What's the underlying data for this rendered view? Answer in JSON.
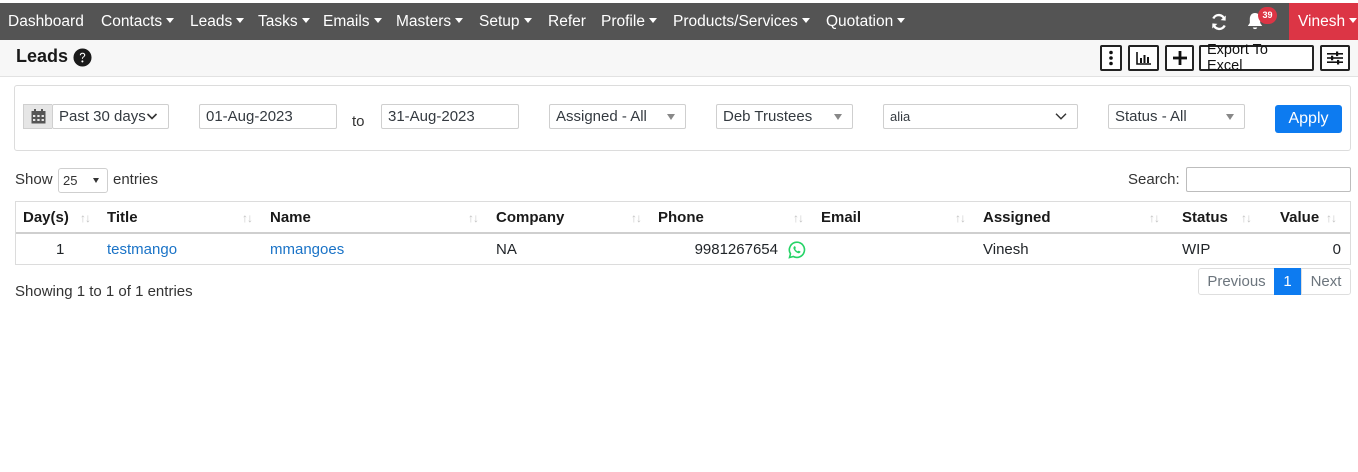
{
  "nav": {
    "items": [
      {
        "label": "Dashboard",
        "dropdown": false
      },
      {
        "label": "Contacts",
        "dropdown": true
      },
      {
        "label": "Leads",
        "dropdown": true
      },
      {
        "label": "Tasks",
        "dropdown": true
      },
      {
        "label": "Emails",
        "dropdown": true
      },
      {
        "label": "Masters",
        "dropdown": true
      },
      {
        "label": "Setup",
        "dropdown": true
      },
      {
        "label": "Refer",
        "dropdown": false
      },
      {
        "label": "Profile",
        "dropdown": true
      },
      {
        "label": "Products/Services",
        "dropdown": true
      },
      {
        "label": "Quotation",
        "dropdown": true
      }
    ],
    "notification_count": "39",
    "user_name": "Vinesh",
    "refresh_icon": "refresh-icon",
    "bell_icon": "bell-icon"
  },
  "header": {
    "title": "Leads",
    "help_icon": "question-circle-icon",
    "toolbar": {
      "menu_icon": "vertical-dots-icon",
      "chart_icon": "bar-chart-icon",
      "add_icon": "plus-icon",
      "export_label": "Export To Excel",
      "settings_icon": "sliders-icon"
    }
  },
  "filters": {
    "calendar_icon": "calendar-icon",
    "date_range": "Past 30 days",
    "from_date": "01-Aug-2023",
    "to_label": "to",
    "to_date": "31-Aug-2023",
    "assigned": "Assigned - All",
    "trustee": "Deb Trustees",
    "search_value": "alia",
    "status": "Status - All",
    "apply_label": "Apply"
  },
  "table_controls": {
    "show_label": "Show",
    "page_length": "25",
    "entries_label": "entries",
    "search_label": "Search:"
  },
  "table": {
    "columns": [
      "Day(s)",
      "Title",
      "Name",
      "Company",
      "Phone",
      "Email",
      "Assigned",
      "Status",
      "Value"
    ],
    "rows": [
      {
        "days": "1",
        "title": "testmango",
        "name": "mmangoes",
        "company": "NA",
        "phone": "9981267654",
        "email": "",
        "assigned": "Vinesh",
        "status": "WIP",
        "value": "0"
      }
    ],
    "whatsapp_icon": "whatsapp-icon"
  },
  "footer": {
    "info": "Showing 1 to 1 of 1 entries",
    "previous_label": "Previous",
    "current_page": "1",
    "next_label": "Next"
  },
  "colors": {
    "navbar": "#545454",
    "user_button": "#dc3545",
    "apply_button": "#0d7bf0",
    "link": "#1a73c7",
    "whatsapp": "#25d366"
  }
}
